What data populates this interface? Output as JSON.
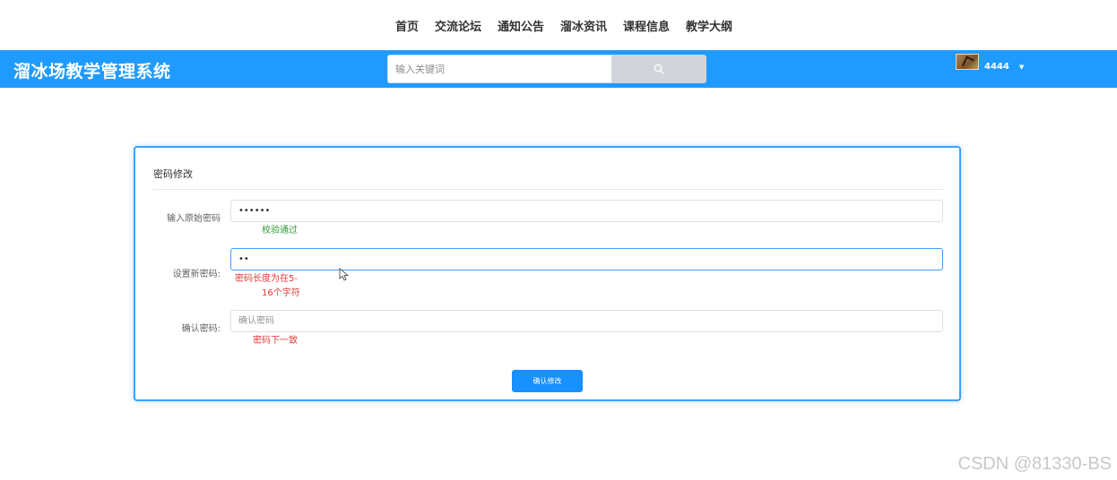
{
  "nav": {
    "items": [
      {
        "label": "首页"
      },
      {
        "label": "交流论坛"
      },
      {
        "label": "通知公告"
      },
      {
        "label": "溜冰资讯"
      },
      {
        "label": "课程信息"
      },
      {
        "label": "教学大纲"
      }
    ]
  },
  "header": {
    "brand": "溜冰场教学管理系统",
    "search": {
      "placeholder": "输入关键词",
      "value": ""
    },
    "user": {
      "name": "4444"
    },
    "colors": {
      "bar": "#1f9bff"
    }
  },
  "form": {
    "title": "密码修改",
    "fields": [
      {
        "label": "输入原始密码",
        "value": "••••••",
        "placeholder": "",
        "message": "校验通过",
        "status": "ok"
      },
      {
        "label": "设置新密码:",
        "value": "••",
        "placeholder": "",
        "message_line1": "密码长度为在5-",
        "message_line2": "16个字符",
        "status": "error"
      },
      {
        "label": "确认密码:",
        "value": "",
        "placeholder": "确认密码",
        "message": "密码下一致",
        "status": "error"
      }
    ],
    "submit_label": "确认修改"
  },
  "watermark": "CSDN @81330-BS"
}
